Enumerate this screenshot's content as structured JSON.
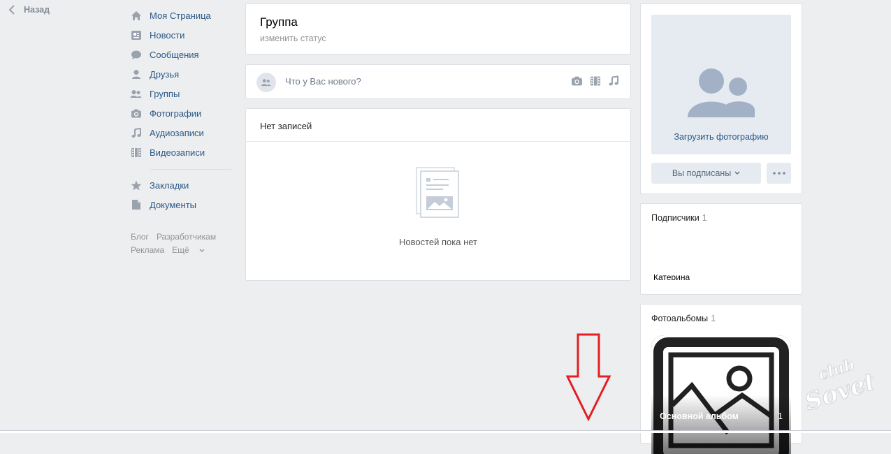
{
  "back": {
    "label": "Назад"
  },
  "sidebar": {
    "items": [
      {
        "label": "Моя Страница",
        "icon": "home-icon"
      },
      {
        "label": "Новости",
        "icon": "news-icon"
      },
      {
        "label": "Сообщения",
        "icon": "messages-icon"
      },
      {
        "label": "Друзья",
        "icon": "friends-icon"
      },
      {
        "label": "Группы",
        "icon": "groups-icon"
      },
      {
        "label": "Фотографии",
        "icon": "camera-icon"
      },
      {
        "label": "Аудиозаписи",
        "icon": "music-icon"
      },
      {
        "label": "Видеозаписи",
        "icon": "film-icon"
      }
    ],
    "items2": [
      {
        "label": "Закладки",
        "icon": "star-icon"
      },
      {
        "label": "Документы",
        "icon": "document-icon"
      }
    ],
    "footer": {
      "blog": "Блог",
      "dev": "Разработчикам",
      "ads": "Реклама",
      "more": "Ещё"
    }
  },
  "group": {
    "title": "Группа",
    "status_link": "изменить статус"
  },
  "post": {
    "placeholder": "Что у Вас нового?"
  },
  "wall": {
    "header": "Нет записей",
    "empty": "Новостей пока нет"
  },
  "photo": {
    "upload": "Загрузить фотографию"
  },
  "actions": {
    "subscribed": "Вы подписаны"
  },
  "subscribers": {
    "title": "Подписчики",
    "count": "1",
    "name": "Катерина"
  },
  "albums": {
    "title": "Фотоальбомы",
    "count": "1",
    "album_name": "Основной альбом",
    "album_count": "1"
  },
  "watermark": {
    "text": "club Sovet"
  },
  "colors": {
    "link": "#2a5885",
    "icon": "#99a2ad",
    "arrow": "#e31e24",
    "bg": "#edeef0"
  }
}
